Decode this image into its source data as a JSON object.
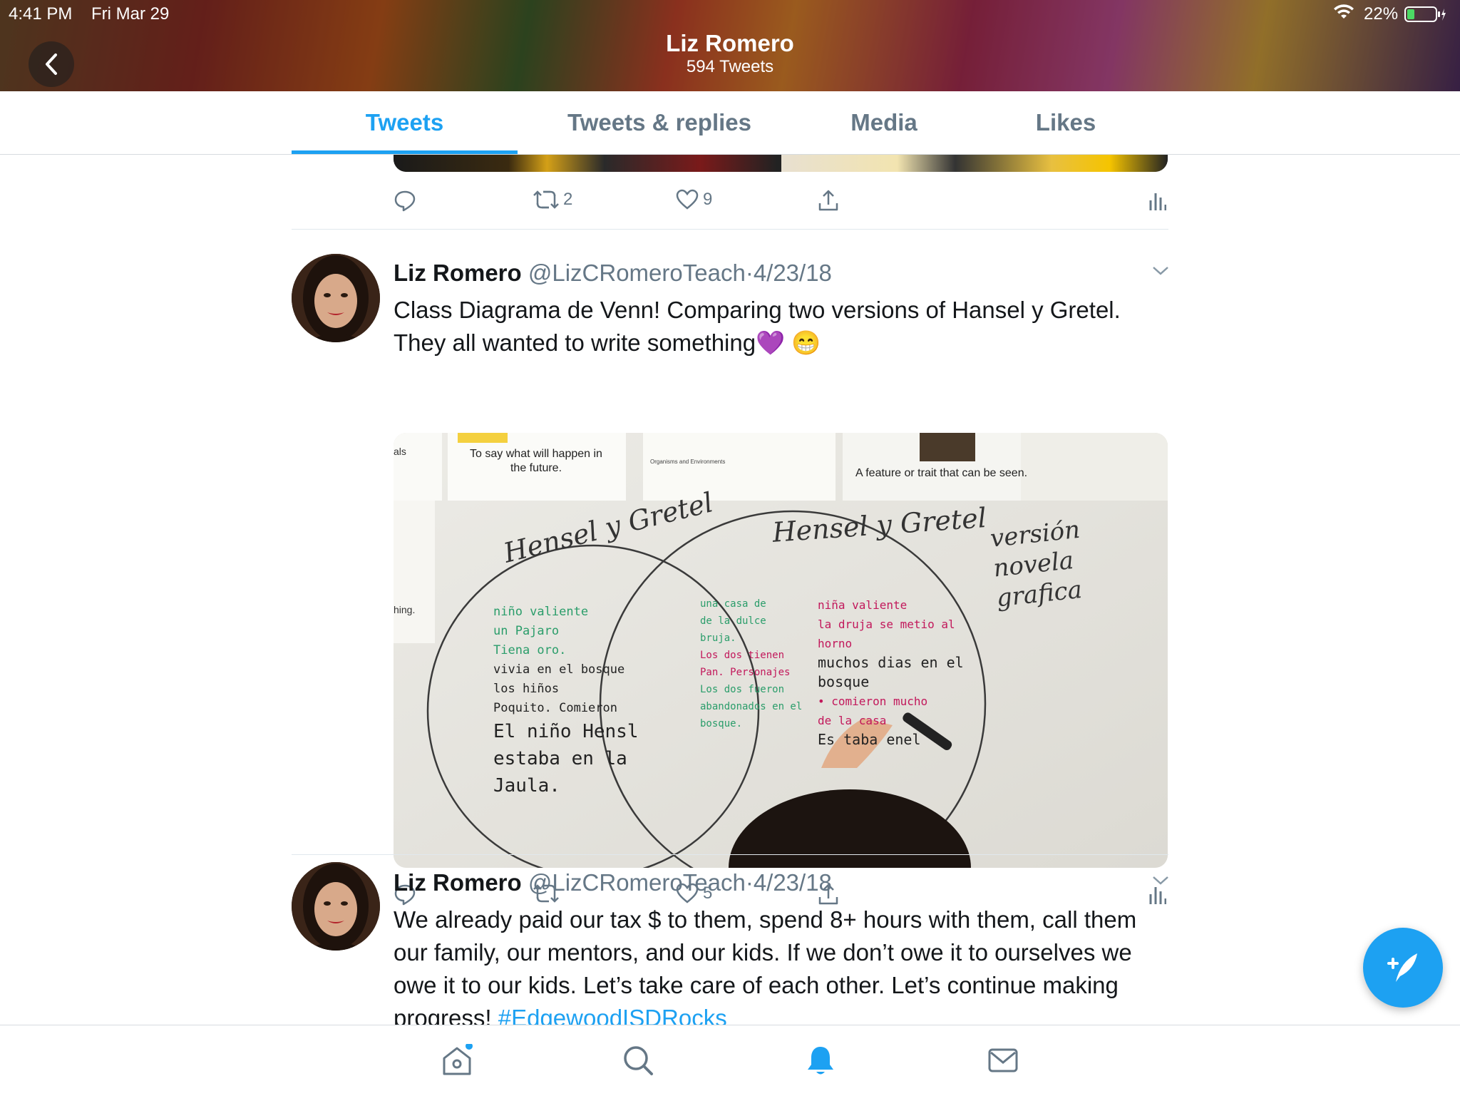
{
  "status_bar": {
    "time": "4:41 PM",
    "date": "Fri Mar 29",
    "battery": "22%",
    "wifi_icon": "wifi-icon"
  },
  "header": {
    "title": "Liz Romero",
    "subtitle": "594 Tweets"
  },
  "tabs": [
    {
      "label": "Tweets",
      "active": true
    },
    {
      "label": "Tweets & replies",
      "active": false
    },
    {
      "label": "Media",
      "active": false
    },
    {
      "label": "Likes",
      "active": false
    }
  ],
  "prev_tweet": {
    "retweets": "2",
    "likes": "9"
  },
  "tweets": [
    {
      "name": "Liz Romero",
      "handle": "@LizCRomeroTeach",
      "sep": "·",
      "date": "4/23/18",
      "text": "Class Diagrama de Venn! Comparing two versions of Hansel y Gretel. They all wanted to write something💜 😁",
      "retweets": "",
      "likes": "5",
      "photo": {
        "card_left_edge": "als",
        "card1": "To say what will happen in the future.",
        "card2": "Organisms and Environments",
        "card3": "A feature or trait that can be seen.",
        "card_left_lower": "hing.",
        "left_title": "Hensel y Gretel",
        "center_title": "Hensel y Gretel",
        "right_title": "versión novela grafica",
        "left_lines": [
          "niño valiente",
          "un Pajaro",
          "Tiena oro.",
          "vivia en el bosque",
          "los hiños",
          "Poquito. Comieron",
          "El niño Hensl",
          "estaba en la",
          "Jaula."
        ],
        "middle_lines": [
          "una casa de",
          "de la dulce",
          "bruja.",
          "Los dos tienen",
          "Pan. Personajes",
          "Los dos fueron",
          "abandonados en el",
          "bosque."
        ],
        "right_lines": [
          "niña valiente",
          "la druja se metio al",
          "horno",
          "muchos dias en el",
          "bosque",
          "• comieron mucho",
          "de la casa",
          "Es taba enel"
        ]
      }
    },
    {
      "name": "Liz Romero",
      "handle": "@LizCRomeroTeach",
      "sep": "·",
      "date": "4/23/18",
      "text": "We already paid our tax $ to them, spend 8+ hours with them, call them our family, our mentors, and our kids. If we don’t owe it to ourselves we owe it to our kids. Let’s take care of each other. Let’s continue making progress!",
      "hashtag": "#EdgewoodISDRocks"
    }
  ],
  "colors": {
    "accent": "#1da1f2",
    "secondary_text": "#657786",
    "primary_text": "#14171a"
  },
  "bottom_nav": [
    "home-icon",
    "search-icon",
    "notifications-icon",
    "messages-icon"
  ]
}
